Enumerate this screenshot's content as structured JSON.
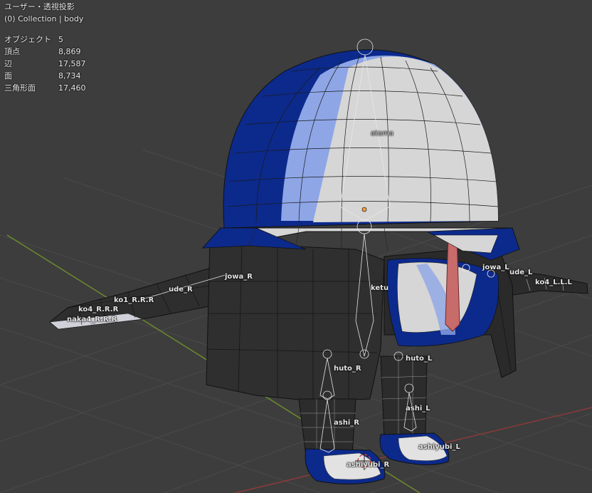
{
  "viewport": {
    "view_mode": "ユーザー・透視投影",
    "collection": "(0) Collection | body"
  },
  "stats": [
    {
      "label": "オブジェクト",
      "value": "5"
    },
    {
      "label": "頂点",
      "value": "8,869"
    },
    {
      "label": "辺",
      "value": "17,587"
    },
    {
      "label": "面",
      "value": "8,734"
    },
    {
      "label": "三角形面",
      "value": "17,460"
    }
  ],
  "bones": {
    "atama": "atama",
    "jowa_r": "jowa_R",
    "jowa_l": "jowa_L",
    "ude_r": "ude_R",
    "ude_l": "ude_L",
    "ketu": "ketu",
    "huto_r": "huto_R",
    "huto_l": "huto_L",
    "ashi_r": "ashi_R",
    "ashi_l": "ashi_L",
    "ashiyubi_r": "ashiyubi_R",
    "ashiyubi_l": "ashiyubi_L",
    "finger_r_1": "ko1_R.R.R",
    "finger_r_2": "ko4_R.R.R",
    "finger_r_3": "naka4_R.R.R",
    "finger_l_1": "ko4_L.L.L"
  },
  "colors": {
    "background": "#3d3d3d",
    "grid": "#4a4a4a",
    "axis_x": "#8b3a3a",
    "axis_y": "#6b8a2c",
    "body_dark": "#2f2f2f",
    "hat_blue": "#0c2a8c",
    "hat_light": "#8ea6e6",
    "hat_white": "#d6d6d6",
    "tie_red": "#c86b6b"
  }
}
